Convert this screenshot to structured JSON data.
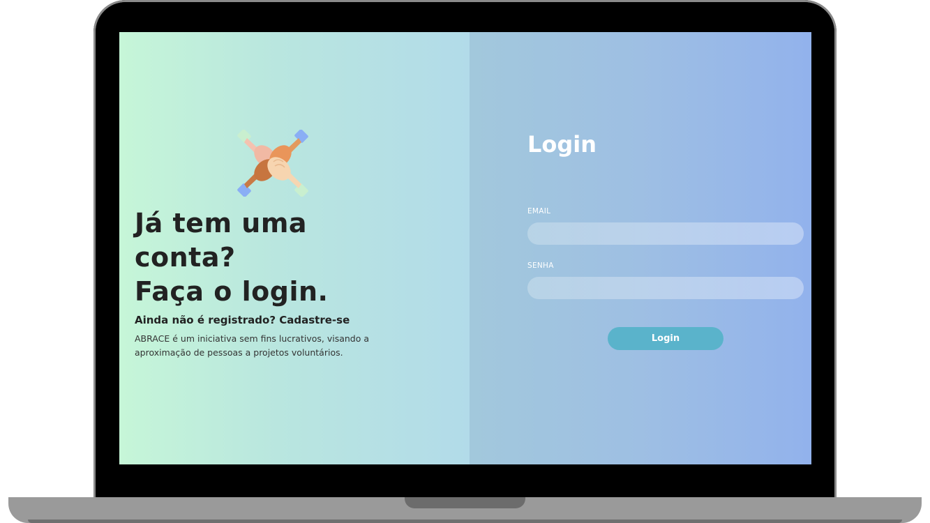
{
  "left": {
    "headline_line1": "Já tem uma",
    "headline_line2": "conta?",
    "headline_line3": "Faça o login.",
    "register_text": "Ainda não é registrado? Cadastre-se",
    "description": "ABRACE é um iniciativa sem fins lucrativos, visando a aproximação de pessoas a projetos voluntários.",
    "logo_icon": "stacked-hands-icon"
  },
  "login": {
    "title": "Login",
    "email_label": "EMAIL",
    "email_value": "",
    "senha_label": "SENHA",
    "senha_value": "",
    "button_label": "Login"
  },
  "colors": {
    "left_gradient_start": "#c6f6d8",
    "left_gradient_end": "#b2dbe9",
    "right_gradient_start": "#a2c8dc",
    "right_gradient_end": "#92b2ec",
    "button": "#5ab3cb",
    "text_dark": "#222222"
  }
}
